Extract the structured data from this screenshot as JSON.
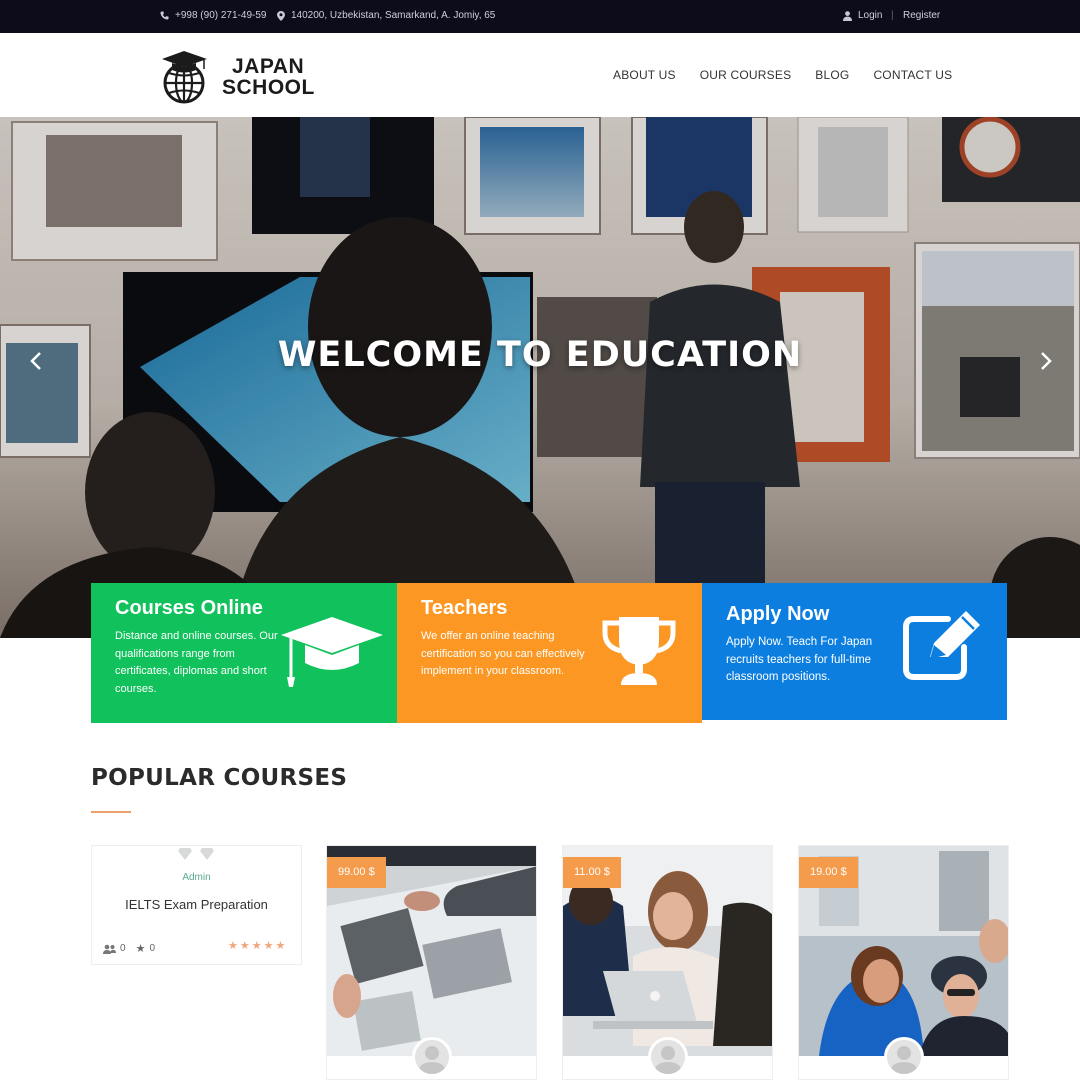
{
  "topbar": {
    "phone": "+998 (90) 271-49-59",
    "address": "140200, Uzbekistan, Samarkand, A. Jomiy, 65",
    "login": "Login",
    "separator": "|",
    "register": "Register"
  },
  "header": {
    "logo_line1": "JAPAN",
    "logo_line2": "SCHOOL",
    "nav": [
      "ABOUT US",
      "OUR COURSES",
      "BLOG",
      "CONTACT US"
    ]
  },
  "hero": {
    "title": "WELCOME TO EDUCATION"
  },
  "features": [
    {
      "title": "Courses Online",
      "text": "Distance and online courses. Our qualifications range from certificates, diplomas and short courses.",
      "icon": "graduation-cap-icon",
      "color": "#11c15b"
    },
    {
      "title": "Teachers",
      "text": "We offer an online teaching certification so you can effectively implement in your classroom.",
      "icon": "trophy-icon",
      "color": "#fb9722"
    },
    {
      "title": "Apply Now",
      "text": "Apply Now. Teach For Japan recruits teachers for full-time classroom positions.",
      "icon": "edit-icon",
      "color": "#0b7ee0"
    }
  ],
  "popular": {
    "title": "POPULAR COURSES",
    "card1": {
      "author": "Admin",
      "name": "IELTS Exam Preparation",
      "students": "0",
      "rating_count": "0",
      "stars": 5
    },
    "cards": [
      {
        "price": "99.00 $"
      },
      {
        "price": "11.00 $"
      },
      {
        "price": "19.00 $"
      }
    ]
  }
}
